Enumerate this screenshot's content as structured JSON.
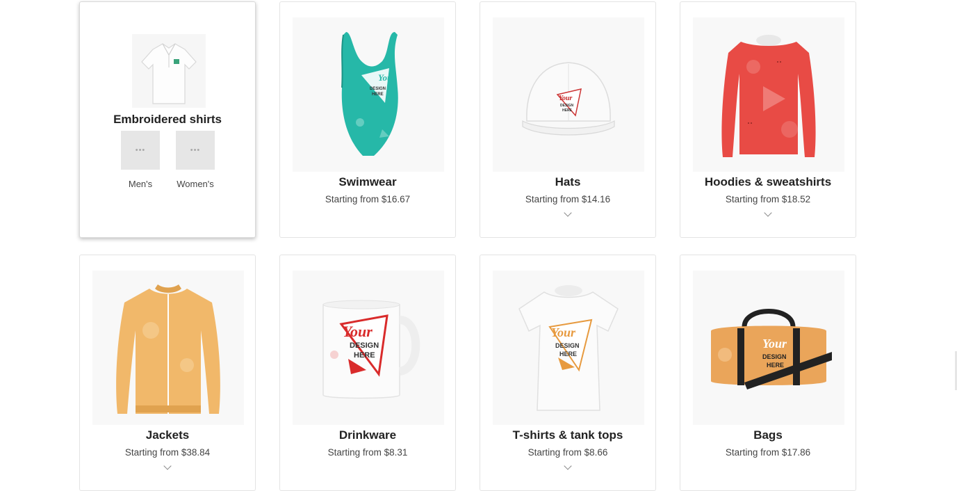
{
  "colors": {
    "swimwear_teal": "#26b8a8",
    "hoodie_red": "#e84b45",
    "jacket_orange": "#f1b86a",
    "bag_orange": "#eaa55a",
    "accent_red": "#d92b2b",
    "design_orange": "#e79a3f"
  },
  "expanded_card": {
    "title": "Embroidered shirts",
    "subcategories": [
      {
        "label": "Men's",
        "thumb_text": "•••"
      },
      {
        "label": "Women's",
        "thumb_text": "•••"
      }
    ]
  },
  "products": [
    {
      "title": "Swimwear",
      "price": "Starting from $16.67",
      "image": "swimsuit-image"
    },
    {
      "title": "Hats",
      "price": "Starting from $14.16",
      "image": "hat-image"
    },
    {
      "title": "Hoodies & sweatshirts",
      "price": "Starting from $18.52",
      "image": "sweatshirt-image"
    },
    {
      "title": "Jackets",
      "price": "Starting from $38.84",
      "image": "jacket-image"
    },
    {
      "title": "Drinkware",
      "price": "Starting from $8.31",
      "image": "mug-image"
    },
    {
      "title": "T-shirts & tank tops",
      "price": "Starting from $8.66",
      "image": "tshirt-image"
    },
    {
      "title": "Bags",
      "price": "Starting from $17.86",
      "image": "duffel-bag-image"
    }
  ],
  "design_badge": {
    "word1": "Your",
    "word2": "DESIGN",
    "word3": "HERE"
  }
}
